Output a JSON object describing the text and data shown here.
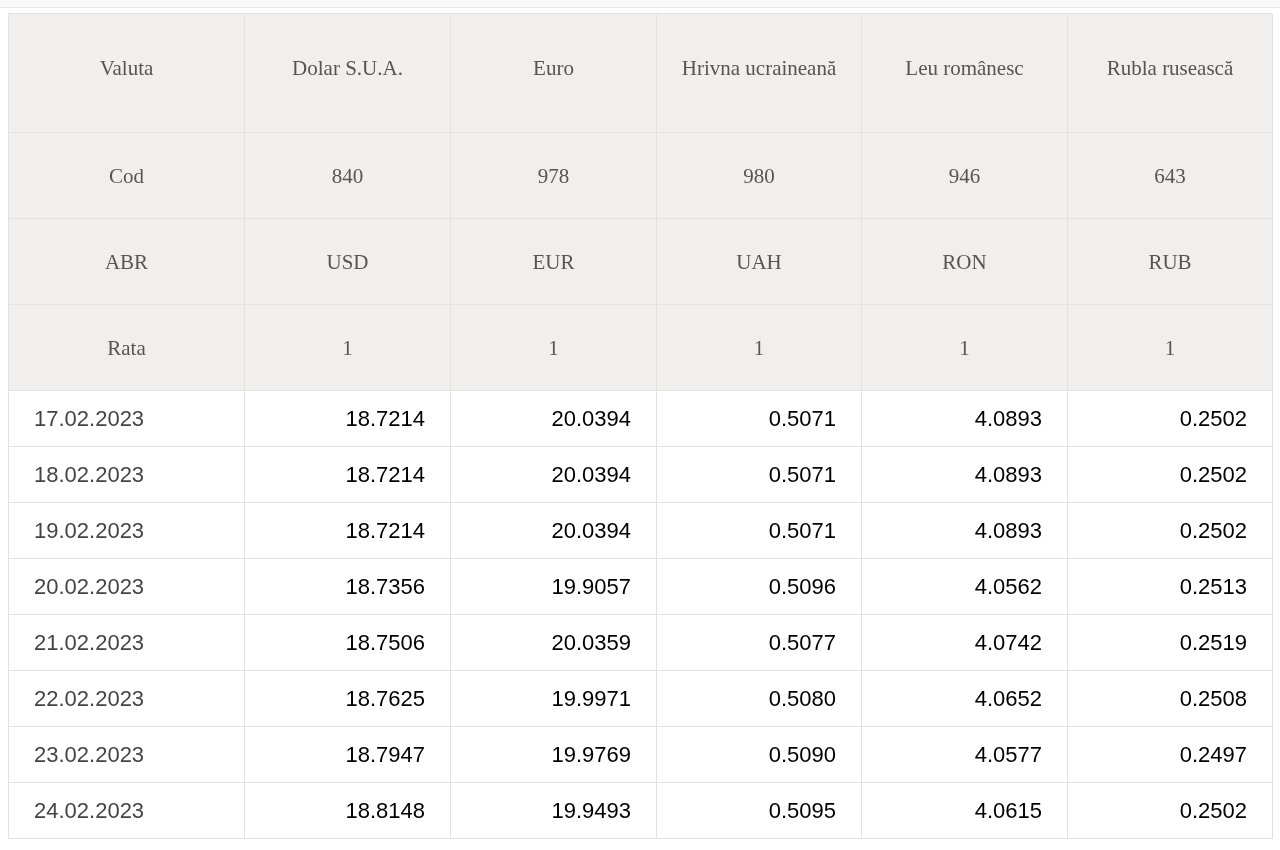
{
  "table": {
    "header_rows": [
      {
        "label": "Valuta",
        "cells": [
          "Dolar S.U.A.",
          "Euro",
          "Hrivna ucraineană",
          "Leu românesc",
          "Rubla rusească"
        ]
      },
      {
        "label": "Cod",
        "cells": [
          "840",
          "978",
          "980",
          "946",
          "643"
        ]
      },
      {
        "label": "ABR",
        "cells": [
          "USD",
          "EUR",
          "UAH",
          "RON",
          "RUB"
        ]
      },
      {
        "label": "Rata",
        "cells": [
          "1",
          "1",
          "1",
          "1",
          "1"
        ]
      }
    ],
    "rows": [
      {
        "date": "17.02.2023",
        "values": [
          "18.7214",
          "20.0394",
          "0.5071",
          "4.0893",
          "0.2502"
        ]
      },
      {
        "date": "18.02.2023",
        "values": [
          "18.7214",
          "20.0394",
          "0.5071",
          "4.0893",
          "0.2502"
        ]
      },
      {
        "date": "19.02.2023",
        "values": [
          "18.7214",
          "20.0394",
          "0.5071",
          "4.0893",
          "0.2502"
        ]
      },
      {
        "date": "20.02.2023",
        "values": [
          "18.7356",
          "19.9057",
          "0.5096",
          "4.0562",
          "0.2513"
        ]
      },
      {
        "date": "21.02.2023",
        "values": [
          "18.7506",
          "20.0359",
          "0.5077",
          "4.0742",
          "0.2519"
        ]
      },
      {
        "date": "22.02.2023",
        "values": [
          "18.7625",
          "19.9971",
          "0.5080",
          "4.0652",
          "0.2508"
        ]
      },
      {
        "date": "23.02.2023",
        "values": [
          "18.7947",
          "19.9769",
          "0.5090",
          "4.0577",
          "0.2497"
        ]
      },
      {
        "date": "24.02.2023",
        "values": [
          "18.8148",
          "19.9493",
          "0.5095",
          "4.0615",
          "0.2502"
        ]
      }
    ]
  }
}
